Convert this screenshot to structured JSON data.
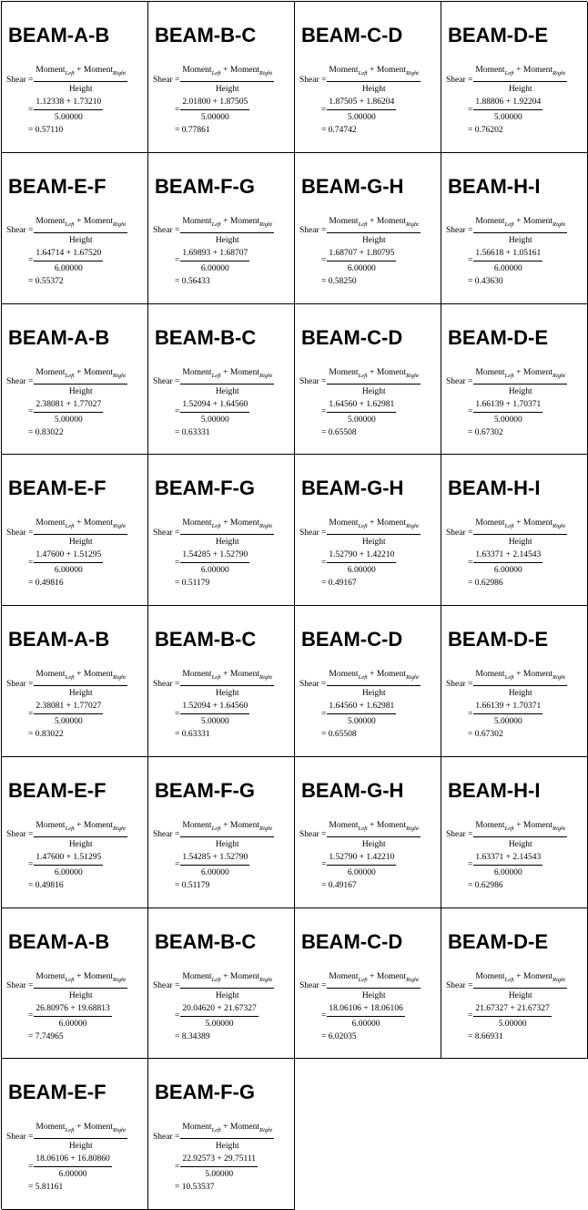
{
  "formula": {
    "shear_label": "Shear =",
    "moment_word": "Moment",
    "left_sub": "Left",
    "right_sub": "Right",
    "plus": " + ",
    "height_word": "Height",
    "equals": "="
  },
  "beams": [
    {
      "title": "BEAM-A-B",
      "left": "1.12338",
      "right": "1.73210",
      "height": "5.00000",
      "result": "= 0.57110"
    },
    {
      "title": "BEAM-B-C",
      "left": "2.01800",
      "right": "1.87505",
      "height": "5.00000",
      "result": "= 0.77861"
    },
    {
      "title": "BEAM-C-D",
      "left": "1.87505",
      "right": "1.86204",
      "height": "5.00000",
      "result": "= 0.74742"
    },
    {
      "title": "BEAM-D-E",
      "left": "1.88806",
      "right": "1.92204",
      "height": "5.00000",
      "result": "= 0.76202"
    },
    {
      "title": "BEAM-E-F",
      "left": "1.64714",
      "right": "1.67520",
      "height": "6.00000",
      "result": "= 0.55372"
    },
    {
      "title": "BEAM-F-G",
      "left": "1.69893",
      "right": "1.68707",
      "height": "6.00000",
      "result": "= 0.56433"
    },
    {
      "title": "BEAM-G-H",
      "left": "1.68707",
      "right": "1.80795",
      "height": "6.00000",
      "result": "= 0.58250"
    },
    {
      "title": "BEAM-H-I",
      "left": "1.56618",
      "right": "1.05161",
      "height": "6.00000",
      "result": "= 0.43630"
    },
    {
      "title": "BEAM-A-B",
      "left": "2.38081",
      "right": "1.77027",
      "height": "5.00000",
      "result": "= 0.83022"
    },
    {
      "title": "BEAM-B-C",
      "left": "1.52094",
      "right": "1.64560",
      "height": "5.00000",
      "result": "= 0.63331"
    },
    {
      "title": "BEAM-C-D",
      "left": "1.64560",
      "right": "1.62981",
      "height": "5.00000",
      "result": "= 0.65508"
    },
    {
      "title": "BEAM-D-E",
      "left": "1.66139",
      "right": "1.70371",
      "height": "5.00000",
      "result": "= 0.67302"
    },
    {
      "title": "BEAM-E-F",
      "left": "1.47600",
      "right": "1.51295",
      "height": "6.00000",
      "result": "= 0.49816"
    },
    {
      "title": "BEAM-F-G",
      "left": "1.54285",
      "right": "1.52790",
      "height": "6.00000",
      "result": "= 0.51179"
    },
    {
      "title": "BEAM-G-H",
      "left": "1.52790",
      "right": "1.42210",
      "height": "6.00000",
      "result": "= 0.49167"
    },
    {
      "title": "BEAM-H-I",
      "left": "1.63371",
      "right": "2.14543",
      "height": "6.00000",
      "result": "= 0.62986"
    },
    {
      "title": "BEAM-A-B",
      "left": "2.38081",
      "right": "1.77027",
      "height": "5.00000",
      "result": "= 0.83022"
    },
    {
      "title": "BEAM-B-C",
      "left": "1.52094",
      "right": "1.64560",
      "height": "5.00000",
      "result": "= 0.63331"
    },
    {
      "title": "BEAM-C-D",
      "left": "1.64560",
      "right": "1.62981",
      "height": "5.00000",
      "result": "= 0.65508"
    },
    {
      "title": "BEAM-D-E",
      "left": "1.66139",
      "right": "1.70371",
      "height": "5.00000",
      "result": "= 0.67302"
    },
    {
      "title": "BEAM-E-F",
      "left": "1.47600",
      "right": "1.51295",
      "height": "6.00000",
      "result": "= 0.49816"
    },
    {
      "title": "BEAM-F-G",
      "left": "1.54285",
      "right": "1.52790",
      "height": "6.00000",
      "result": "= 0.51179"
    },
    {
      "title": "BEAM-G-H",
      "left": "1.52790",
      "right": "1.42210",
      "height": "6.00000",
      "result": "= 0.49167"
    },
    {
      "title": "BEAM-H-I",
      "left": "1.63371",
      "right": "2.14543",
      "height": "6.00000",
      "result": "= 0.62986"
    },
    {
      "title": "BEAM-A-B",
      "left": "26.80976",
      "right": "19.68813",
      "height": "6.00000",
      "result": "= 7.74965"
    },
    {
      "title": "BEAM-B-C",
      "left": "20.04620",
      "right": "21.67327",
      "height": "5.00000",
      "result": "= 8.34389"
    },
    {
      "title": "BEAM-C-D",
      "left": "18.06106",
      "right": "18.06106",
      "height": "6.00000",
      "result": "= 6.02035"
    },
    {
      "title": "BEAM-D-E",
      "left": "21.67327",
      "right": "21.67327",
      "height": "5.00000",
      "result": "= 8.66931"
    },
    {
      "title": "BEAM-E-F",
      "left": "18.06106",
      "right": "16.80860",
      "height": "6.00000",
      "result": "= 5.81161"
    },
    {
      "title": "BEAM-F-G",
      "left": "22.92573",
      "right": "29.75111",
      "height": "5.00000",
      "result": "= 10.53537"
    }
  ]
}
